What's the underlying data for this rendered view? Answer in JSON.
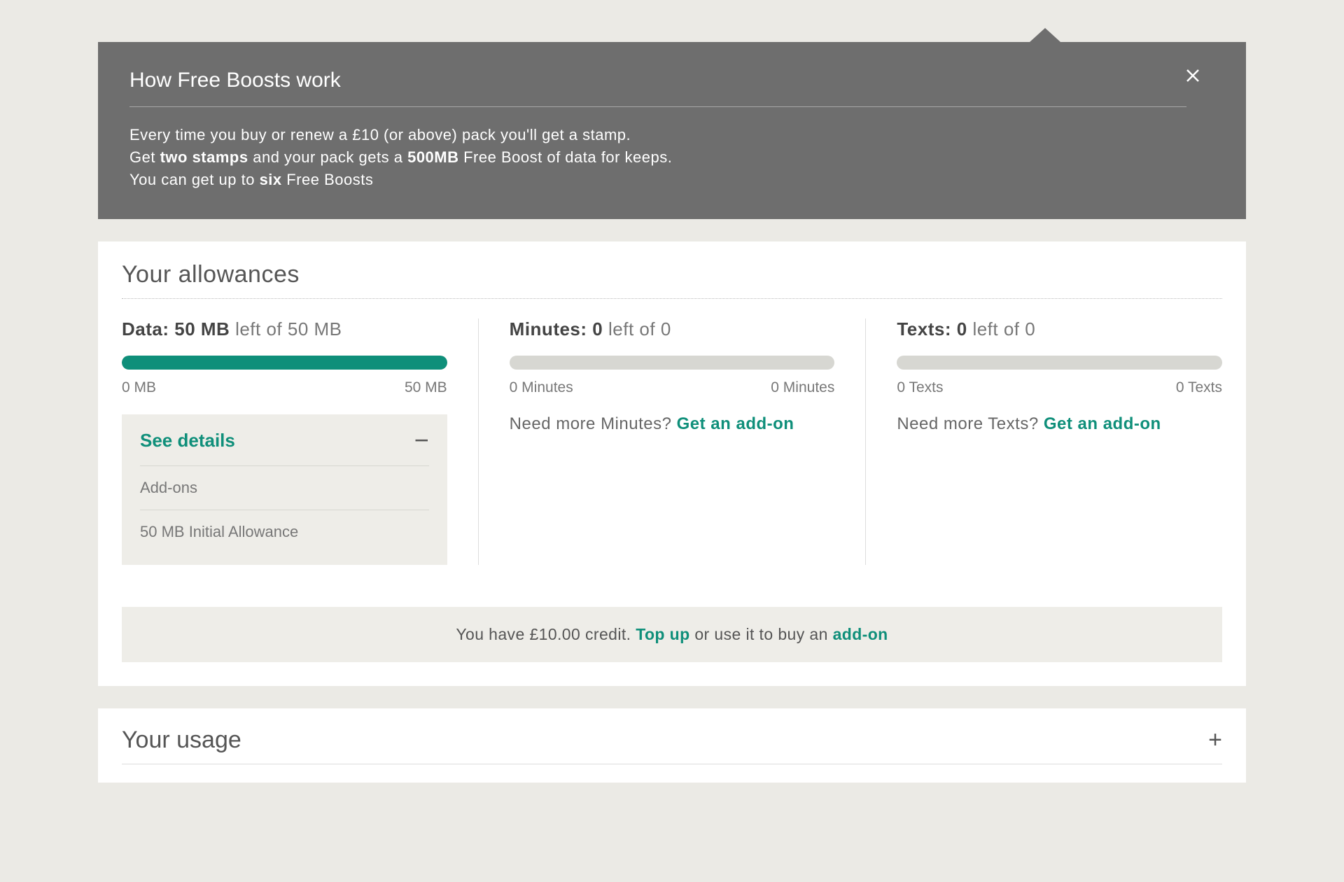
{
  "info": {
    "title": "How Free Boosts work",
    "line1": "Every time you buy or renew a £10 (or above) pack you'll get a stamp.",
    "line2_pre": "Get ",
    "line2_bold1": "two stamps",
    "line2_mid": " and your pack gets a ",
    "line2_bold2": "500MB",
    "line2_post": " Free Boost of data for keeps.",
    "line3_pre": "You can get up to ",
    "line3_bold": "six",
    "line3_post": " Free Boosts"
  },
  "allowances": {
    "title": "Your allowances",
    "data": {
      "label": "Data:",
      "value": "50 MB",
      "rest": "left of 50 MB",
      "min": "0 MB",
      "max": "50 MB",
      "fillPercent": 100
    },
    "minutes": {
      "label": "Minutes:",
      "value": "0",
      "rest": "left of 0",
      "min": "0 Minutes",
      "max": "0 Minutes",
      "needText": "Need more Minutes? ",
      "needLink": "Get an add-on"
    },
    "texts": {
      "label": "Texts:",
      "value": "0",
      "rest": "left of 0",
      "min": "0 Texts",
      "max": "0 Texts",
      "needText": "Need more Texts? ",
      "needLink": "Get an add-on"
    },
    "details": {
      "toggle": "See details",
      "item1": "Add-ons",
      "item2": "50 MB Initial Allowance"
    },
    "credit": {
      "pre": "You have £10.00 credit. ",
      "link1": "Top up",
      "mid": " or use it to buy an ",
      "link2": "add-on"
    }
  },
  "usage": {
    "title": "Your usage"
  }
}
